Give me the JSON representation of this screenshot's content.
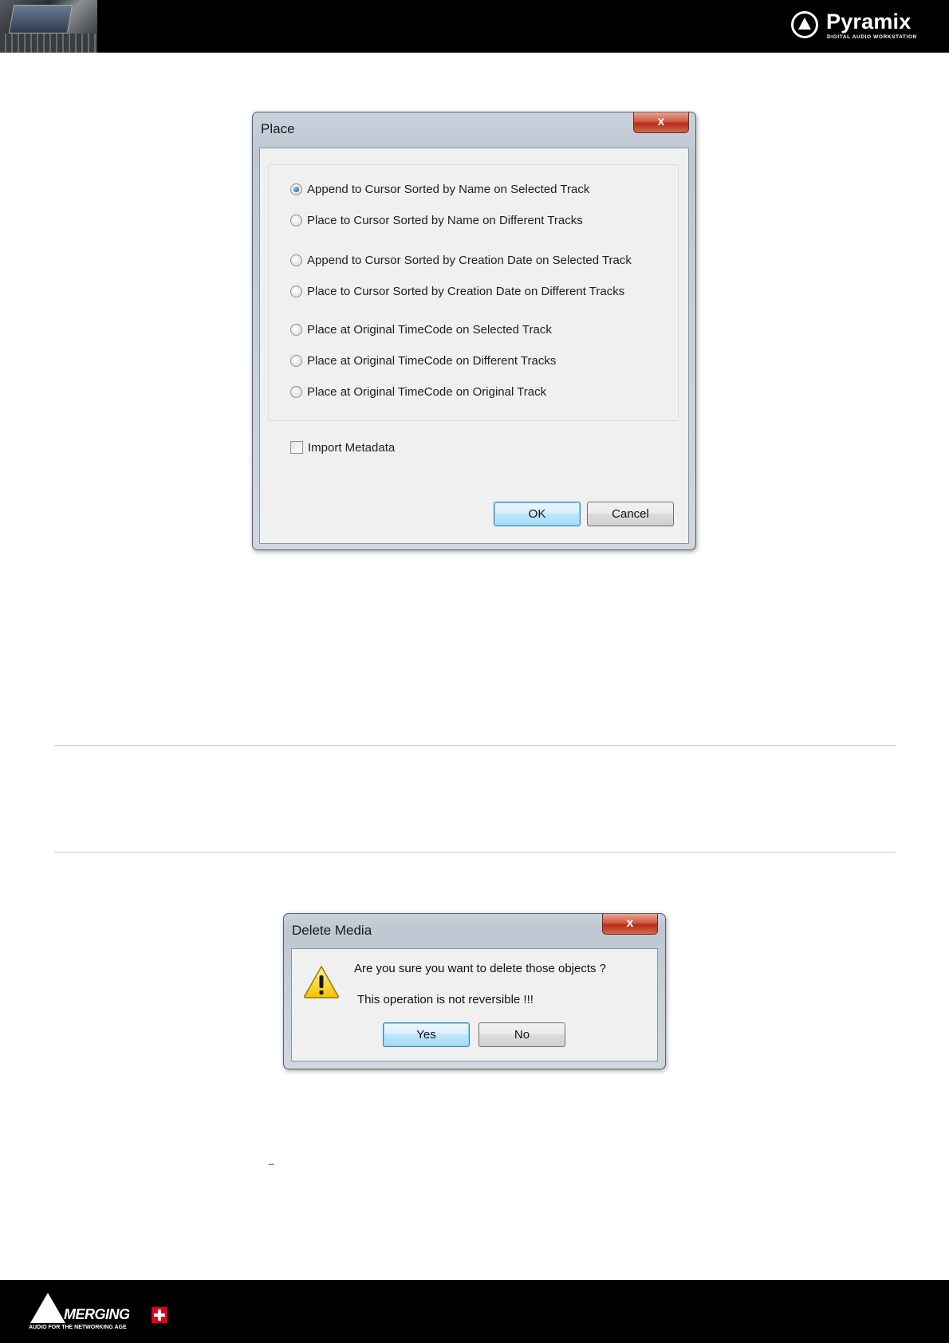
{
  "header": {
    "brand_name": "Pyramix",
    "brand_subtitle": "DIGITAL AUDIO WORKSTATION",
    "photo_icon": "studio-console-photo",
    "logo_icon": "pyramix-triangle-logo-icon"
  },
  "place_dialog": {
    "title": "Place",
    "close_label": "x",
    "options": [
      {
        "label": "Append to Cursor Sorted by Name on Selected Track",
        "checked": true
      },
      {
        "label": "Place to Cursor Sorted by Name on Different Tracks",
        "checked": false
      },
      {
        "label": "Append to Cursor Sorted by Creation Date on Selected Track",
        "checked": false
      },
      {
        "label": "Place to Cursor Sorted by Creation Date on Different Tracks",
        "checked": false
      },
      {
        "label": "Place at Original TimeCode on Selected Track",
        "checked": false
      },
      {
        "label": "Place at Original TimeCode on Different Tracks",
        "checked": false
      },
      {
        "label": "Place at Original TimeCode on Original Track",
        "checked": false
      }
    ],
    "import_metadata": {
      "label": "Import Metadata",
      "checked": false
    },
    "ok_label": "OK",
    "cancel_label": "Cancel"
  },
  "delete_dialog": {
    "title": "Delete Media",
    "close_label": "x",
    "message": "Are you sure you want to delete those objects ?",
    "warning": "This operation is not reversible !!!",
    "yes_label": "Yes",
    "no_label": "No",
    "icon": "warning-icon"
  },
  "stray_mark": "–",
  "footer": {
    "brand_name": "MERGING",
    "tagline": "AUDIO FOR THE NETWORKING AGE",
    "brand_color": "#e2001a"
  }
}
